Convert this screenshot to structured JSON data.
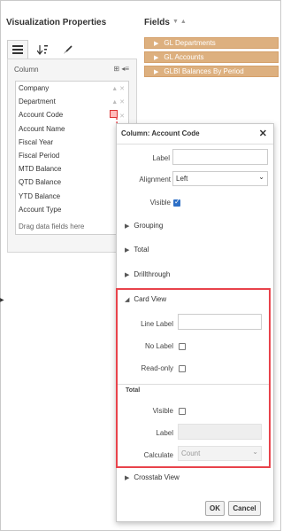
{
  "header": {
    "vis_title": "Visualization Properties",
    "fields_title": "Fields",
    "fields_sort": "▼ ▲"
  },
  "fields": [
    {
      "label": "GL Departments"
    },
    {
      "label": "GL Accounts"
    },
    {
      "label": "GLBI Balances By Period"
    }
  ],
  "column_panel": {
    "heading": "Column",
    "rows": [
      {
        "label": "Company"
      },
      {
        "label": "Department"
      },
      {
        "label": "Account Code"
      },
      {
        "label": "Account Name"
      },
      {
        "label": "Fiscal Year"
      },
      {
        "label": "Fiscal Period"
      },
      {
        "label": "MTD Balance"
      },
      {
        "label": "QTD Balance"
      },
      {
        "label": "YTD Balance"
      },
      {
        "label": "Account Type"
      }
    ],
    "drag_hint": "Drag data fields here"
  },
  "dialog": {
    "title": "Column: Account Code",
    "close": "✕",
    "label_label": "Label",
    "alignment_label": "Alignment",
    "alignment_value": "Left",
    "visible_label": "Visible",
    "visible_checked": true,
    "sections": {
      "grouping": "Grouping",
      "total": "Total",
      "drillthrough": "Drillthrough",
      "card_view": "Card View",
      "crosstab_view": "Crosstab View"
    },
    "card_view": {
      "line_label": "Line Label",
      "no_label": "No Label",
      "read_only": "Read-only",
      "total_heading": "Total",
      "total_visible": "Visible",
      "total_label": "Label",
      "calculate_label": "Calculate",
      "calculate_value": "Count"
    },
    "ok_label": "OK",
    "cancel_label": "Cancel"
  },
  "colors": {
    "field_bg": "#ddb07f",
    "highlight": "#e8434b",
    "checkbox_checked": "#2d6fc6"
  }
}
